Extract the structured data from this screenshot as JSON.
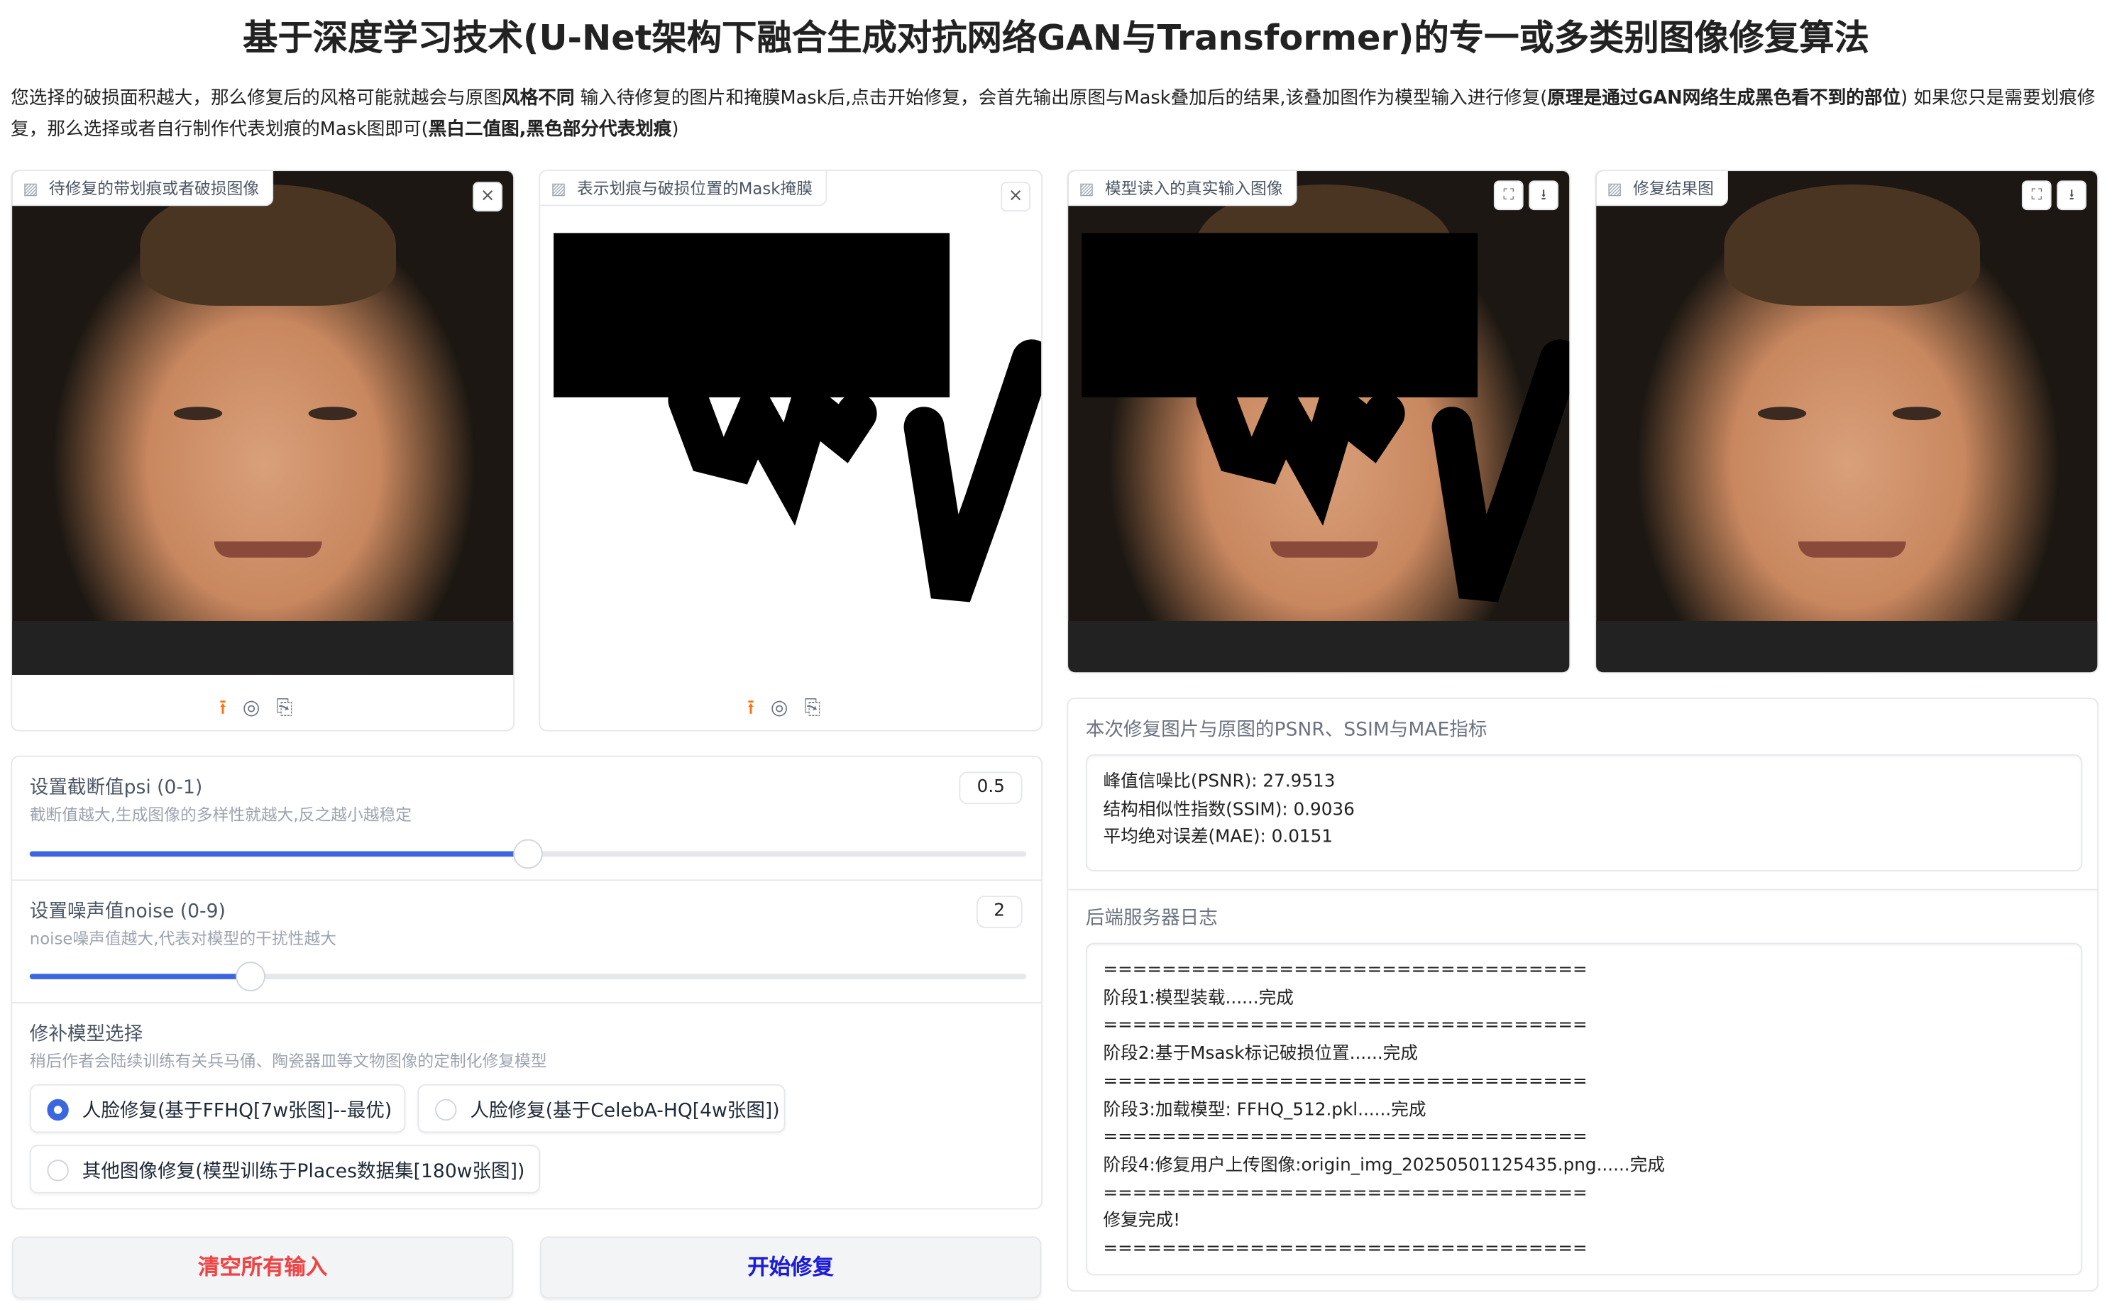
{
  "title": "基于深度学习技术(U-Net架构下融合生成对抗网络GAN与Transformer)的专一或多类别图像修复算法",
  "description": {
    "p1": "您选择的破损面积越大，那么修复后的风格可能就越会与原图",
    "b1": "风格不同",
    "p2": " 输入待修复的图片和掩膜Mask后,点击开始修复，会首先输出原图与Mask叠加后的结果,该叠加图作为模型输入进行修复(",
    "b2": "原理是通过GAN网络生成黑色看不到的部位",
    "p3": ") 如果您只是需要划痕修复，那么选择或者自行制作代表划痕的Mask图即可(",
    "b3": "黑白二值图,黑色部分代表划痕",
    "p4": ")"
  },
  "images": {
    "input_label": "待修复的带划痕或者破损图像",
    "mask_label": "表示划痕与破损位置的Mask掩膜",
    "model_input_label": "模型读入的真实输入图像",
    "result_label": "修复结果图"
  },
  "icons": {
    "upload": "⭱",
    "webcam": "◎",
    "clipboard": "⎘",
    "close": "×",
    "fullscreen": "⛶",
    "download": "⭳",
    "image": "▨"
  },
  "psi": {
    "label": "设置截断值psi (0-1)",
    "info": "截断值越大,生成图像的多样性就越大,反之越小越稳定",
    "value": "0.5",
    "fraction": 0.5
  },
  "noise": {
    "label": "设置噪声值noise (0-9)",
    "info": "noise噪声值越大,代表对模型的干扰性越大",
    "value": "2",
    "fraction": 0.2222
  },
  "model": {
    "label": "修补模型选择",
    "info": "稍后作者会陆续训练有关兵马俑、陶瓷器皿等文物图像的定制化修复模型",
    "options": [
      "人脸修复(基于FFHQ[7w张图]--最优)",
      "人脸修复(基于CelebA-HQ[4w张图])",
      "其他图像修复(模型训练于Places数据集[180w张图])"
    ],
    "selected": 0
  },
  "buttons": {
    "clear": "清空所有输入",
    "start": "开始修复"
  },
  "metrics": {
    "label": "本次修复图片与原图的PSNR、SSIM与MAE指标",
    "text": "峰值信噪比(PSNR): 27.9513\n结构相似性指数(SSIM): 0.9036\n平均绝对误差(MAE): 0.0151"
  },
  "log": {
    "label": "后端服务器日志",
    "text": "=================================\n阶段1:模型装载......完成\n=================================\n阶段2:基于Msask标记破损位置......完成\n=================================\n阶段3:加载模型: FFHQ_512.pkl......完成\n=================================\n阶段4:修复用户上传图像:origin_img_20250501125435.png......完成\n=================================\n修复完成!\n================================="
  },
  "colors": {
    "accent": "#3b66e0",
    "clear": "#ef4444",
    "start": "#1d1dd8"
  }
}
